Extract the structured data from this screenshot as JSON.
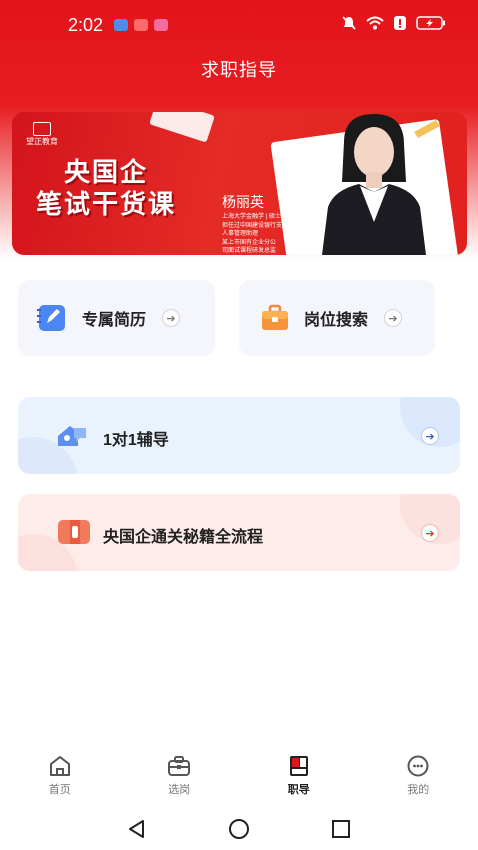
{
  "status_bar": {
    "time": "2:02"
  },
  "header": {
    "title": "求职指导"
  },
  "banner": {
    "brand": "望正教育",
    "line1": "央国企",
    "line2": "笔试干货课",
    "teacher_name": "杨丽英",
    "bio": [
      "上海大学金融学 | 硕士",
      "担任过中国建设银行支行",
      "人事管理助理",
      "某上市国有企业分公",
      "司面试课程研发总监"
    ]
  },
  "cards": {
    "resume": {
      "label": "专属简历"
    },
    "job_search": {
      "label": "岗位搜索"
    },
    "tutoring": {
      "label": "1对1辅导"
    },
    "guide": {
      "label": "央国企通关秘籍全流程"
    }
  },
  "tabs": [
    {
      "label": "首页",
      "icon": "home-icon",
      "active": false
    },
    {
      "label": "选岗",
      "icon": "briefcase-icon",
      "active": false
    },
    {
      "label": "职导",
      "icon": "guide-book-icon",
      "active": true
    },
    {
      "label": "我的",
      "icon": "profile-face-icon",
      "active": false
    }
  ],
  "colors": {
    "brand_red": "#e3141b",
    "tutor_bg": "#e9f2fd",
    "guide_bg": "#fdecea",
    "accent_blue": "#3f7ef0",
    "accent_orange": "#f07a3a"
  }
}
